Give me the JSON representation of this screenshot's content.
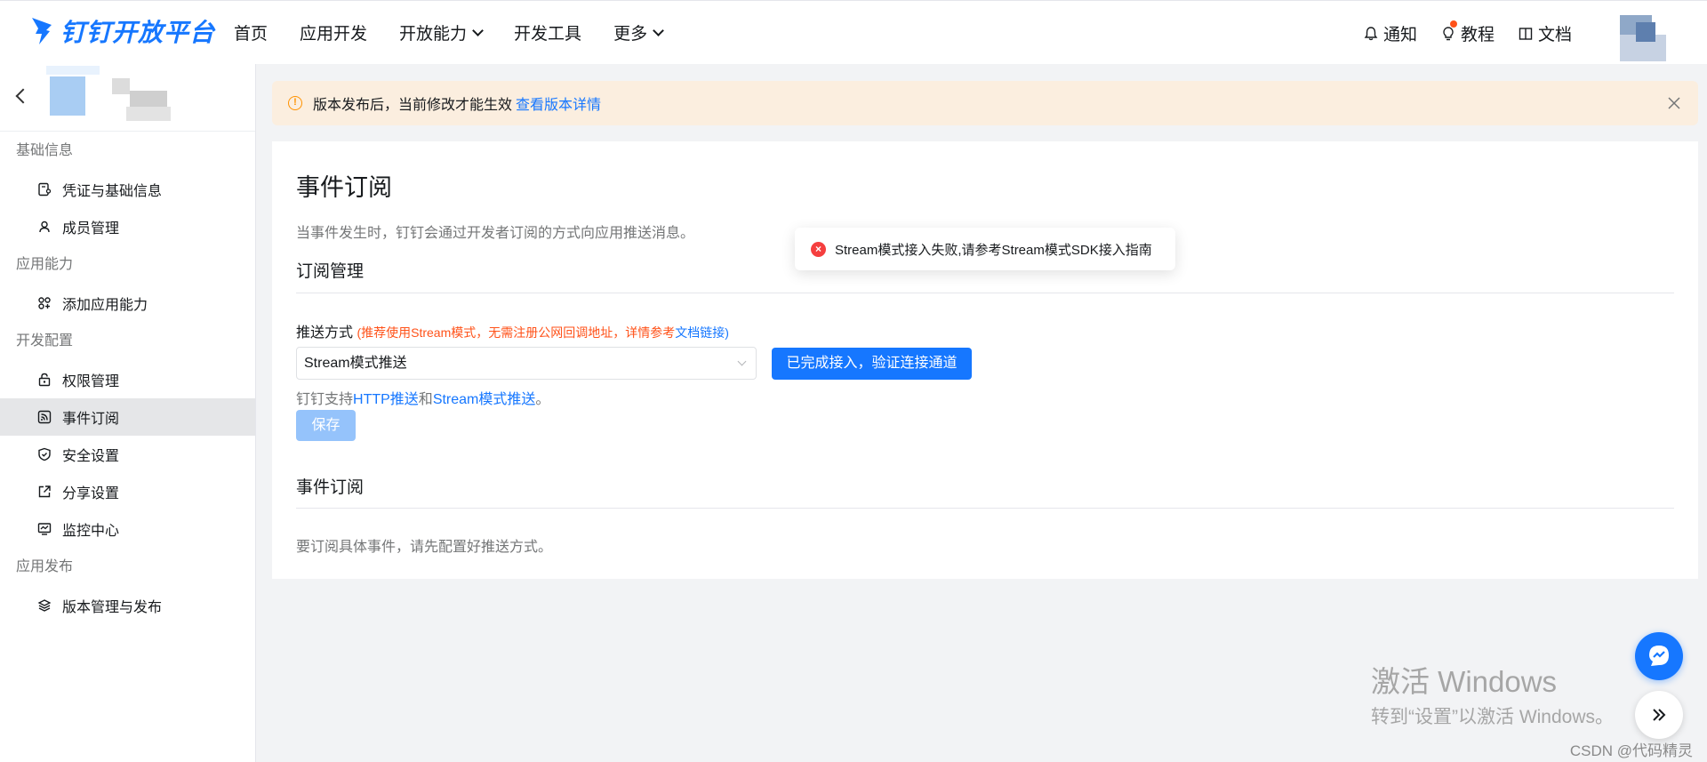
{
  "brand": {
    "name": "钉钉开放平台"
  },
  "nav": {
    "items": [
      "首页",
      "应用开发",
      "开放能力",
      "开发工具",
      "更多"
    ],
    "right": {
      "notify": "通知",
      "tutorial": "教程",
      "docs": "文档"
    }
  },
  "sidebar": {
    "sections": [
      {
        "title": "基础信息",
        "items": [
          "凭证与基础信息",
          "成员管理"
        ]
      },
      {
        "title": "应用能力",
        "items": [
          "添加应用能力"
        ]
      },
      {
        "title": "开发配置",
        "items": [
          "权限管理",
          "事件订阅",
          "安全设置",
          "分享设置",
          "监控中心"
        ]
      },
      {
        "title": "应用发布",
        "items": [
          "版本管理与发布"
        ]
      }
    ],
    "active_item": "事件订阅"
  },
  "banner": {
    "text": "版本发布后，当前修改才能生效",
    "link": "查看版本详情"
  },
  "page": {
    "title": "事件订阅",
    "description": "当事件发生时，钉钉会通过开发者订阅的方式向应用推送消息。",
    "subscription_mgmt_title": "订阅管理",
    "push_label": "推送方式",
    "push_hint_prefix": "(推荐使用Stream模式，无需注册公网回调地址，详情参考",
    "push_hint_link": "文档链接",
    "push_hint_suffix": ")",
    "push_mode_value": "Stream模式推送",
    "verify_button": "已完成接入，验证连接通道",
    "support_prefix": "钉钉支持",
    "support_http": "HTTP推送",
    "support_and": "和",
    "support_stream": "Stream模式推送",
    "support_end": "。",
    "save_button": "保存",
    "event_sub_title": "事件订阅",
    "event_sub_empty": "要订阅具体事件，请先配置好推送方式。"
  },
  "toast": {
    "message": "Stream模式接入失败,请参考Stream模式SDK接入指南"
  },
  "watermark": {
    "line1": "激活 Windows",
    "line2": "转到“设置”以激活 Windows。"
  },
  "credit": "CSDN @代码精灵",
  "colors": {
    "accent": "#1677ff",
    "warning_bg": "#fbeedf",
    "error": "#f53f3f",
    "hint_red": "#ff5219"
  }
}
